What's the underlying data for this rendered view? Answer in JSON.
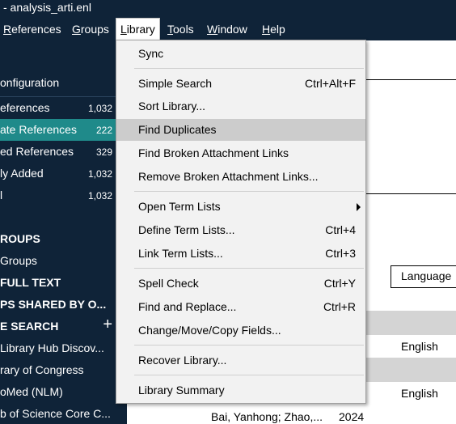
{
  "window": {
    "title": "- analysis_arti.enl"
  },
  "menubar": [
    {
      "label": "References",
      "ul": "R"
    },
    {
      "label": "Groups",
      "ul": "G"
    },
    {
      "label": "Library",
      "ul": "L"
    },
    {
      "label": "Tools",
      "ul": "T"
    },
    {
      "label": "Window",
      "ul": "W"
    },
    {
      "label": "Help",
      "ul": "H"
    }
  ],
  "sidebar": {
    "items": [
      {
        "label": "onfiguration",
        "count": ""
      },
      {
        "label": "eferences",
        "count": "1,032"
      },
      {
        "label": "ate References",
        "count": "222"
      },
      {
        "label": "ed References",
        "count": "329"
      },
      {
        "label": "ly Added",
        "count": "1,032"
      },
      {
        "label": "l",
        "count": "1,032"
      }
    ],
    "sections": [
      {
        "label": "ROUPS"
      },
      {
        "label": " Groups"
      },
      {
        "label": "FULL TEXT"
      },
      {
        "label": "PS SHARED BY O..."
      },
      {
        "label": "E SEARCH"
      }
    ],
    "online": [
      {
        "label": " Library Hub Discov..."
      },
      {
        "label": "rary of Congress"
      },
      {
        "label": "oMed (NLM)"
      },
      {
        "label": "b of Science Core C..."
      }
    ]
  },
  "library_menu": {
    "items": [
      {
        "label": "Sync",
        "shortcut": ""
      },
      {
        "label": "Simple Search",
        "shortcut": "Ctrl+Alt+F"
      },
      {
        "label": "Sort Library...",
        "shortcut": ""
      },
      {
        "label": "Find Duplicates",
        "shortcut": ""
      },
      {
        "label": "Find Broken Attachment Links",
        "shortcut": ""
      },
      {
        "label": "Remove Broken Attachment Links...",
        "shortcut": ""
      },
      {
        "label": "Open Term Lists",
        "shortcut": ""
      },
      {
        "label": "Define Term Lists...",
        "shortcut": "Ctrl+4"
      },
      {
        "label": "Link Term Lists...",
        "shortcut": "Ctrl+3"
      },
      {
        "label": "Spell Check",
        "shortcut": "Ctrl+Y"
      },
      {
        "label": "Find and Replace...",
        "shortcut": "Ctrl+R"
      },
      {
        "label": "Change/Move/Copy Fields...",
        "shortcut": ""
      },
      {
        "label": "Recover Library...",
        "shortcut": ""
      },
      {
        "label": "Library Summary",
        "shortcut": ""
      }
    ]
  },
  "table": {
    "column_language": "Language",
    "rows": [
      {
        "language": "English"
      },
      {
        "language": "English"
      }
    ],
    "last_row": {
      "author": "Bai, Yanhong; Zhao,...",
      "year": "2024"
    }
  },
  "colors": {
    "sidebar_bg": "#0f2338",
    "selected_item": "#1f8a8a",
    "menu_highlight": "#cccccc"
  }
}
